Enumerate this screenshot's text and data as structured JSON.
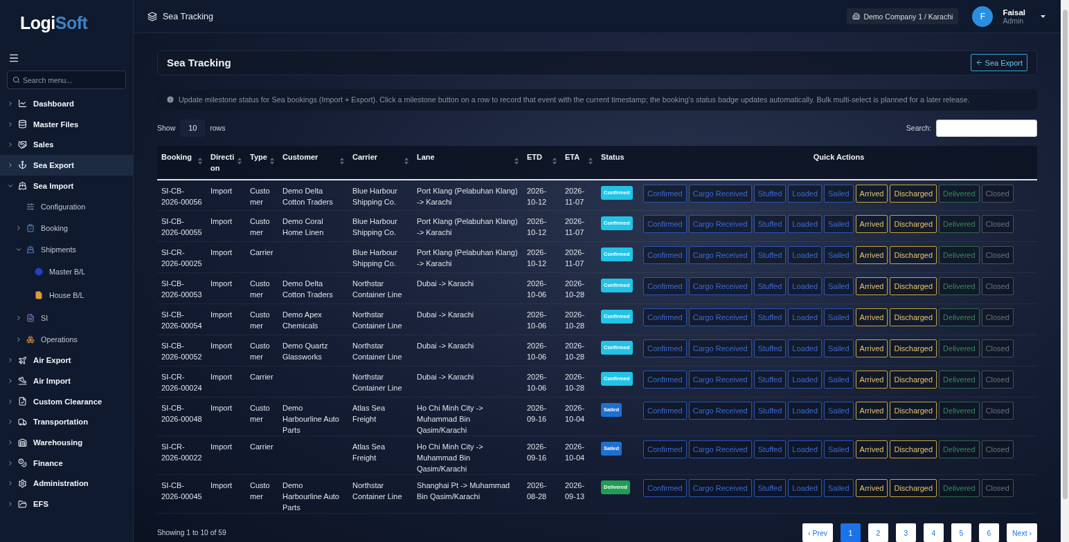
{
  "logo": [
    "Logi",
    "Soft"
  ],
  "sidebar": {
    "search_placeholder": "Search menu...",
    "items": [
      {
        "label": "Dashboard",
        "expanded": false,
        "selected": false
      },
      {
        "label": "Master Files",
        "expanded": false,
        "selected": false
      },
      {
        "label": "Sales",
        "expanded": false,
        "selected": false
      },
      {
        "label": "Sea Export",
        "expanded": false,
        "selected": true
      },
      {
        "label": "Sea Import",
        "expanded": true,
        "selected": false,
        "children": [
          {
            "label": "Configuration",
            "selected": false
          },
          {
            "label": "Booking",
            "expanded": false,
            "selected": false
          },
          {
            "label": "Shipments",
            "expanded": true,
            "selected": false,
            "children": [
              {
                "label": "Master B/L",
                "selected": false
              },
              {
                "label": "House B/L",
                "selected": false
              }
            ]
          },
          {
            "label": "SI",
            "expanded": false,
            "selected": false
          },
          {
            "label": "Operations",
            "expanded": false,
            "selected": false
          }
        ]
      },
      {
        "label": "Air Export",
        "expanded": false,
        "selected": false
      },
      {
        "label": "Air Import",
        "expanded": false,
        "selected": false
      },
      {
        "label": "Custom Clearance",
        "expanded": false,
        "selected": false
      },
      {
        "label": "Transportation",
        "expanded": false,
        "selected": false
      },
      {
        "label": "Warehousing",
        "expanded": false,
        "selected": false
      },
      {
        "label": "Finance",
        "expanded": false,
        "selected": false
      },
      {
        "label": "Administration",
        "expanded": false,
        "selected": false
      },
      {
        "label": "EFS",
        "expanded": false,
        "selected": false
      }
    ]
  },
  "header": {
    "title": "Sea Tracking",
    "company": "Demo Company 1 / Karachi",
    "user": {
      "initial": "F",
      "name": "Faisal",
      "role": "Admin"
    }
  },
  "page": {
    "title": "Sea Tracking",
    "back_button": "Sea Export",
    "info": "Update milestone status for Sea bookings (Import + Export). Click a milestone button on a row to record that event with the current timestamp; the booking's status badge updates automatically. Bulk multi-select is planned for a later release.",
    "show_label": "Show",
    "rows_value": "10",
    "rows_label": "rows",
    "search_label": "Search:"
  },
  "table": {
    "columns": [
      {
        "label": "Booking",
        "sortable": true
      },
      {
        "label": "Direction",
        "sortable": true
      },
      {
        "label": "Type",
        "sortable": true
      },
      {
        "label": "Customer",
        "sortable": true
      },
      {
        "label": "Carrier",
        "sortable": true
      },
      {
        "label": "Lane",
        "sortable": true
      },
      {
        "label": "ETD",
        "sortable": true
      },
      {
        "label": "ETA",
        "sortable": true
      },
      {
        "label": "Status",
        "sortable": false
      },
      {
        "label": "Quick Actions",
        "sortable": false
      }
    ],
    "rows": [
      {
        "booking": "SI-CB-2026-00056",
        "direction": "Import",
        "type": "Customer",
        "customer": "Demo Delta Cotton Traders",
        "carrier": "Blue Harbour Shipping Co.",
        "lane": "Port Klang (Pelabuhan Klang) -> Karachi",
        "etd": "2026-10-12",
        "eta": "2026-11-07",
        "status": {
          "label": "Confirmed",
          "color": "#22c3e6"
        },
        "actions": [
          {
            "label": "Confirmed",
            "kind": "progress"
          },
          {
            "label": "Cargo Received",
            "kind": "progress"
          },
          {
            "label": "Stuffed",
            "kind": "progress"
          },
          {
            "label": "Loaded",
            "kind": "progress"
          },
          {
            "label": "Sailed",
            "kind": "progress"
          },
          {
            "label": "Arrived",
            "kind": "arrival"
          },
          {
            "label": "Discharged",
            "kind": "arrival"
          },
          {
            "label": "Delivered",
            "kind": "delivery"
          },
          {
            "label": "Closed",
            "kind": "closure"
          }
        ]
      },
      {
        "booking": "SI-CB-2026-00055",
        "direction": "Import",
        "type": "Customer",
        "customer": "Demo Coral Home Linen",
        "carrier": "Blue Harbour Shipping Co.",
        "lane": "Port Klang (Pelabuhan Klang) -> Karachi",
        "etd": "2026-10-12",
        "eta": "2026-11-07",
        "status": {
          "label": "Confirmed",
          "color": "#22c3e6"
        },
        "actions": [
          {
            "label": "Confirmed",
            "kind": "progress"
          },
          {
            "label": "Cargo Received",
            "kind": "progress"
          },
          {
            "label": "Stuffed",
            "kind": "progress"
          },
          {
            "label": "Loaded",
            "kind": "progress"
          },
          {
            "label": "Sailed",
            "kind": "progress"
          },
          {
            "label": "Arrived",
            "kind": "arrival"
          },
          {
            "label": "Discharged",
            "kind": "arrival"
          },
          {
            "label": "Delivered",
            "kind": "delivery"
          },
          {
            "label": "Closed",
            "kind": "closure"
          }
        ]
      },
      {
        "booking": "SI-CR-2026-00025",
        "direction": "Import",
        "type": "Carrier",
        "customer": "",
        "carrier": "Blue Harbour Shipping Co.",
        "lane": "Port Klang (Pelabuhan Klang) -> Karachi",
        "etd": "2026-10-12",
        "eta": "2026-11-07",
        "status": {
          "label": "Confirmed",
          "color": "#22c3e6"
        },
        "actions": [
          {
            "label": "Confirmed",
            "kind": "progress"
          },
          {
            "label": "Cargo Received",
            "kind": "progress"
          },
          {
            "label": "Stuffed",
            "kind": "progress"
          },
          {
            "label": "Loaded",
            "kind": "progress"
          },
          {
            "label": "Sailed",
            "kind": "progress"
          },
          {
            "label": "Arrived",
            "kind": "arrival"
          },
          {
            "label": "Discharged",
            "kind": "arrival"
          },
          {
            "label": "Delivered",
            "kind": "delivery"
          },
          {
            "label": "Closed",
            "kind": "closure"
          }
        ]
      },
      {
        "booking": "SI-CB-2026-00053",
        "direction": "Import",
        "type": "Customer",
        "customer": "Demo Delta Cotton Traders",
        "carrier": "Northstar Container Line",
        "lane": "Dubai -> Karachi",
        "etd": "2026-10-06",
        "eta": "2026-10-28",
        "status": {
          "label": "Confirmed",
          "color": "#22c3e6"
        },
        "actions": [
          {
            "label": "Confirmed",
            "kind": "progress"
          },
          {
            "label": "Cargo Received",
            "kind": "progress"
          },
          {
            "label": "Stuffed",
            "kind": "progress"
          },
          {
            "label": "Loaded",
            "kind": "progress"
          },
          {
            "label": "Sailed",
            "kind": "progress"
          },
          {
            "label": "Arrived",
            "kind": "arrival"
          },
          {
            "label": "Discharged",
            "kind": "arrival"
          },
          {
            "label": "Delivered",
            "kind": "delivery"
          },
          {
            "label": "Closed",
            "kind": "closure"
          }
        ]
      },
      {
        "booking": "SI-CB-2026-00054",
        "direction": "Import",
        "type": "Customer",
        "customer": "Demo Apex Chemicals",
        "carrier": "Northstar Container Line",
        "lane": "Dubai -> Karachi",
        "etd": "2026-10-06",
        "eta": "2026-10-28",
        "status": {
          "label": "Confirmed",
          "color": "#22c3e6"
        },
        "actions": [
          {
            "label": "Confirmed",
            "kind": "progress"
          },
          {
            "label": "Cargo Received",
            "kind": "progress"
          },
          {
            "label": "Stuffed",
            "kind": "progress"
          },
          {
            "label": "Loaded",
            "kind": "progress"
          },
          {
            "label": "Sailed",
            "kind": "progress"
          },
          {
            "label": "Arrived",
            "kind": "arrival"
          },
          {
            "label": "Discharged",
            "kind": "arrival"
          },
          {
            "label": "Delivered",
            "kind": "delivery"
          },
          {
            "label": "Closed",
            "kind": "closure"
          }
        ]
      },
      {
        "booking": "SI-CB-2026-00052",
        "direction": "Import",
        "type": "Customer",
        "customer": "Demo Quartz Glassworks",
        "carrier": "Northstar Container Line",
        "lane": "Dubai -> Karachi",
        "etd": "2026-10-06",
        "eta": "2026-10-28",
        "status": {
          "label": "Confirmed",
          "color": "#22c3e6"
        },
        "actions": [
          {
            "label": "Confirmed",
            "kind": "progress"
          },
          {
            "label": "Cargo Received",
            "kind": "progress"
          },
          {
            "label": "Stuffed",
            "kind": "progress"
          },
          {
            "label": "Loaded",
            "kind": "progress"
          },
          {
            "label": "Sailed",
            "kind": "progress"
          },
          {
            "label": "Arrived",
            "kind": "arrival"
          },
          {
            "label": "Discharged",
            "kind": "arrival"
          },
          {
            "label": "Delivered",
            "kind": "delivery"
          },
          {
            "label": "Closed",
            "kind": "closure"
          }
        ]
      },
      {
        "booking": "SI-CR-2026-00024",
        "direction": "Import",
        "type": "Carrier",
        "customer": "",
        "carrier": "Northstar Container Line",
        "lane": "Dubai -> Karachi",
        "etd": "2026-10-06",
        "eta": "2026-10-28",
        "status": {
          "label": "Confirmed",
          "color": "#22c3e6"
        },
        "actions": [
          {
            "label": "Confirmed",
            "kind": "progress"
          },
          {
            "label": "Cargo Received",
            "kind": "progress"
          },
          {
            "label": "Stuffed",
            "kind": "progress"
          },
          {
            "label": "Loaded",
            "kind": "progress"
          },
          {
            "label": "Sailed",
            "kind": "progress"
          },
          {
            "label": "Arrived",
            "kind": "arrival"
          },
          {
            "label": "Discharged",
            "kind": "arrival"
          },
          {
            "label": "Delivered",
            "kind": "delivery"
          },
          {
            "label": "Closed",
            "kind": "closure"
          }
        ]
      },
      {
        "booking": "SI-CB-2026-00048",
        "direction": "Import",
        "type": "Customer",
        "customer": "Demo Harbourline Auto Parts",
        "carrier": "Atlas Sea Freight",
        "lane": "Ho Chi Minh City -> Muhammad Bin Qasim/Karachi",
        "etd": "2026-09-16",
        "eta": "2026-10-04",
        "status": {
          "label": "Sailed",
          "color": "#1f6fd1"
        },
        "actions": [
          {
            "label": "Confirmed",
            "kind": "progress"
          },
          {
            "label": "Cargo Received",
            "kind": "progress"
          },
          {
            "label": "Stuffed",
            "kind": "progress"
          },
          {
            "label": "Loaded",
            "kind": "progress"
          },
          {
            "label": "Sailed",
            "kind": "progress"
          },
          {
            "label": "Arrived",
            "kind": "arrival"
          },
          {
            "label": "Discharged",
            "kind": "arrival"
          },
          {
            "label": "Delivered",
            "kind": "delivery"
          },
          {
            "label": "Closed",
            "kind": "closure"
          }
        ]
      },
      {
        "booking": "SI-CR-2026-00022",
        "direction": "Import",
        "type": "Carrier",
        "customer": "",
        "carrier": "Atlas Sea Freight",
        "lane": "Ho Chi Minh City -> Muhammad Bin Qasim/Karachi",
        "etd": "2026-09-16",
        "eta": "2026-10-04",
        "status": {
          "label": "Sailed",
          "color": "#1f6fd1"
        },
        "actions": [
          {
            "label": "Confirmed",
            "kind": "progress"
          },
          {
            "label": "Cargo Received",
            "kind": "progress"
          },
          {
            "label": "Stuffed",
            "kind": "progress"
          },
          {
            "label": "Loaded",
            "kind": "progress"
          },
          {
            "label": "Sailed",
            "kind": "progress"
          },
          {
            "label": "Arrived",
            "kind": "arrival"
          },
          {
            "label": "Discharged",
            "kind": "arrival"
          },
          {
            "label": "Delivered",
            "kind": "delivery"
          },
          {
            "label": "Closed",
            "kind": "closure"
          }
        ]
      },
      {
        "booking": "SI-CB-2026-00045",
        "direction": "Import",
        "type": "Customer",
        "customer": "Demo Harbourline Auto Parts",
        "carrier": "Northstar Container Line",
        "lane": "Shanghai Pt -> Muhammad Bin Qasim/Karachi",
        "etd": "2026-08-28",
        "eta": "2026-09-13",
        "status": {
          "label": "Delivered",
          "color": "#1f9d55"
        },
        "actions": [
          {
            "label": "Confirmed",
            "kind": "progress"
          },
          {
            "label": "Cargo Received",
            "kind": "progress"
          },
          {
            "label": "Stuffed",
            "kind": "progress"
          },
          {
            "label": "Loaded",
            "kind": "progress"
          },
          {
            "label": "Sailed",
            "kind": "progress"
          },
          {
            "label": "Arrived",
            "kind": "arrival"
          },
          {
            "label": "Discharged",
            "kind": "arrival"
          },
          {
            "label": "Delivered",
            "kind": "delivery"
          },
          {
            "label": "Closed",
            "kind": "closure"
          }
        ]
      }
    ]
  },
  "footer": {
    "summary": "Showing 1 to 10 of 59",
    "pagination": [
      {
        "label": "‹ Prev",
        "selected": false
      },
      {
        "label": "1",
        "selected": true
      },
      {
        "label": "2",
        "selected": false
      },
      {
        "label": "3",
        "selected": false
      },
      {
        "label": "4",
        "selected": false
      },
      {
        "label": "5",
        "selected": false
      },
      {
        "label": "6",
        "selected": false
      },
      {
        "label": "Next ›",
        "selected": false
      }
    ]
  }
}
